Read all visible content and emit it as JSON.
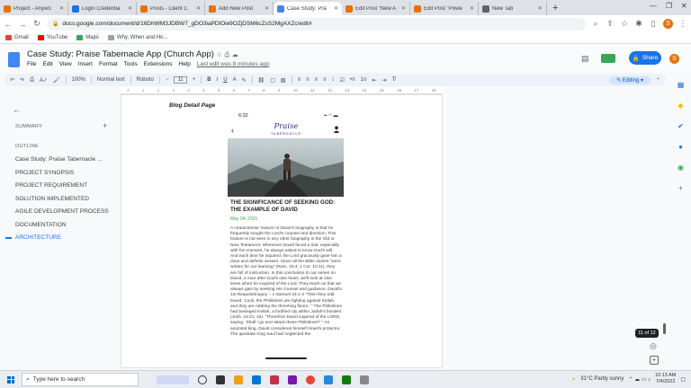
{
  "browser": {
    "tabs": [
      {
        "label": "Project - Anywo",
        "color": "#e37400",
        "active": false
      },
      {
        "label": "Login Credentia",
        "color": "#1a73e8",
        "active": false
      },
      {
        "label": "Posts - Client C",
        "color": "#e8710a",
        "active": false
      },
      {
        "label": "Add New Post",
        "color": "#e8710a",
        "active": false
      },
      {
        "label": "Case Study: Pra",
        "color": "#4285f4",
        "active": true
      },
      {
        "label": "Edit Post \"New A",
        "color": "#e8710a",
        "active": false
      },
      {
        "label": "Edit Post \"Powe",
        "color": "#e8710a",
        "active": false
      },
      {
        "label": "New Tab",
        "color": "#5f6368",
        "active": false
      }
    ],
    "new_tab": "+",
    "url": "docs.google.com/document/d/16DhWM3JDBW7_gDO3iaPDlOie9OZjDSM6cZsS2MgAXZc/edit#",
    "avatar": "S",
    "bookmarks": [
      {
        "label": "Gmail",
        "color": "#ea4335"
      },
      {
        "label": "YouTube",
        "color": "#ff0000"
      },
      {
        "label": "Maps",
        "color": "#34a853"
      },
      {
        "label": "Why, When and Ho...",
        "color": "#5f6368"
      }
    ]
  },
  "docs": {
    "title": "Case Study: Praise Tabernacle App (Church App)",
    "menu": [
      "File",
      "Edit",
      "View",
      "Insert",
      "Format",
      "Tools",
      "Extensions",
      "Help"
    ],
    "last_edit": "Last edit was 8 minutes ago",
    "share": "Share",
    "user_avatar": "S",
    "format": {
      "zoom": "100%",
      "style": "Normal text",
      "font": "Roboto",
      "size": "11",
      "mode": "Editing"
    },
    "ruler": [
      "2",
      "1",
      "1",
      "2",
      "3",
      "4",
      "5",
      "6",
      "7",
      "8",
      "9",
      "10",
      "11",
      "12",
      "13",
      "14",
      "15",
      "16",
      "17",
      "18"
    ]
  },
  "outline": {
    "summary_label": "SUMMARY",
    "add": "+",
    "outline_label": "OUTLINE",
    "items": [
      {
        "label": "Case Study: Praise Tabernacle ...",
        "active": false
      },
      {
        "label": "PROJECT SYNOPSIS",
        "active": false
      },
      {
        "label": "PROJECT REQUIREMENT",
        "active": false
      },
      {
        "label": "SOLUTION IMPLEMENTED",
        "active": false
      },
      {
        "label": "AGILE DEVELOPMENT PROCESS",
        "active": false
      },
      {
        "label": "DOCUMENTATION",
        "active": false
      },
      {
        "label": "ARCHITECTURE",
        "active": true
      }
    ]
  },
  "page": {
    "heading": "Blog Detail Page",
    "phone": {
      "time": "6:32",
      "logo_main": "Praise",
      "logo_sub": "TABERNACLE",
      "post_title": "THE SIGNIFICANCE OF SEEKING GOD: THE EXAMPLE OF DAVID",
      "post_date": "May 04, 2021",
      "post_body": "A characteristic feature of David's biography is that he frequently sought the Lord's counsel and direction. This feature is not seen in any other biography in the Old or New Testament. Whenever David faced a trial, especially with his enemies, he always asked to know God's will. And each time he inquired, the Lord graciously gave him a clear and definite answer. Since all the Bible stories \"were written for our learning\" (Rom. 15:4; 1 Cor. 10:11), they are full of instruction. In this conclusion to our series on David, a man after God's own heart, we'll look at nine times when he inquired of the Lord. They teach us that we always gain by seeking His counsel and guidance. David's 1st Request/Inquiry – 1 Samuel 23:1-3 \"Then they told David, 'Look, the Philistines are fighting against Keilah, and they are robbing the threshing floors.' \" The Philistines had besieged Keilah, a fortified city within Judah's borders (Josh. 15:21, 44). \"Therefore David inquired of the LORD, saying, 'Shall I go and attack these Philistines?' \" As anointed king, David considered himself Israel's protector. The apostate King Saul had neglected the"
    },
    "page_indicator": "11 of 12"
  },
  "taskbar": {
    "search_placeholder": "Type here to search",
    "weather": "31°C  Partly sunny",
    "time": "10:13 AM",
    "date": "7/4/2022"
  }
}
